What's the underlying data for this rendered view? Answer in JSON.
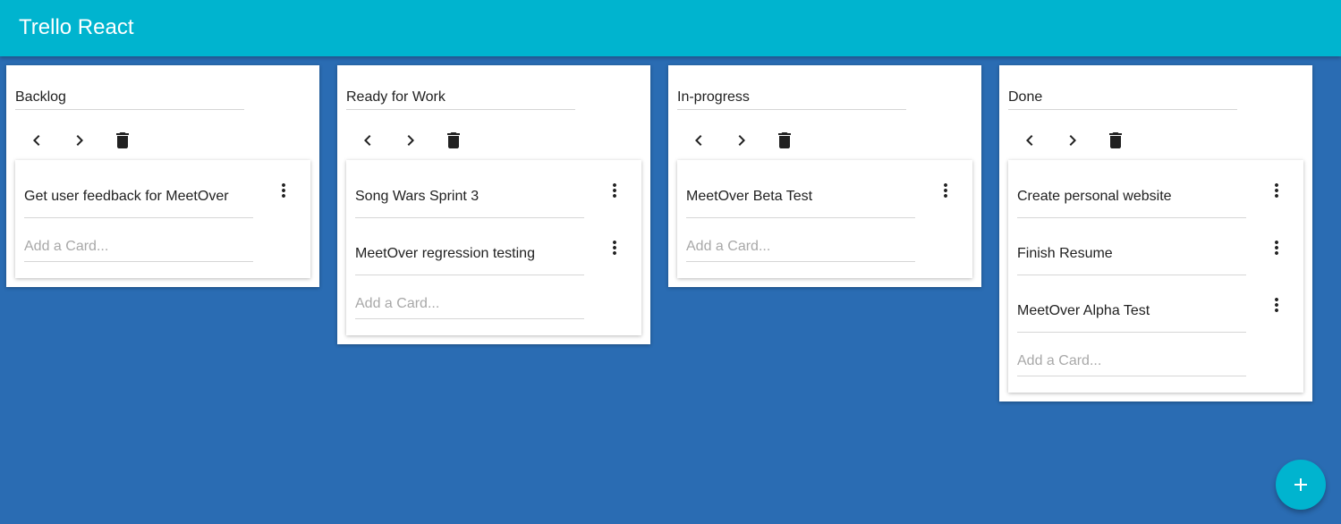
{
  "app": {
    "title": "Trello React"
  },
  "colors": {
    "appbar": "#00b4cf",
    "background": "#2a6cb3",
    "fab": "#00b4cf"
  },
  "icons": {
    "move_left": "chevron-left-icon",
    "move_right": "chevron-right-icon",
    "delete": "trash-icon",
    "card_menu": "more-vert-icon",
    "fab": "plus-icon"
  },
  "lists": [
    {
      "title": "Backlog",
      "cards": [
        "Get user feedback for MeetOver"
      ],
      "add_placeholder": "Add a Card..."
    },
    {
      "title": "Ready for Work",
      "cards": [
        "Song Wars Sprint 3",
        "MeetOver regression testing"
      ],
      "add_placeholder": "Add a Card..."
    },
    {
      "title": "In-progress",
      "cards": [
        "MeetOver Beta Test"
      ],
      "add_placeholder": "Add a Card..."
    },
    {
      "title": "Done",
      "cards": [
        "Create personal website",
        "Finish Resume",
        "MeetOver Alpha Test"
      ],
      "add_placeholder": "Add a Card..."
    }
  ]
}
